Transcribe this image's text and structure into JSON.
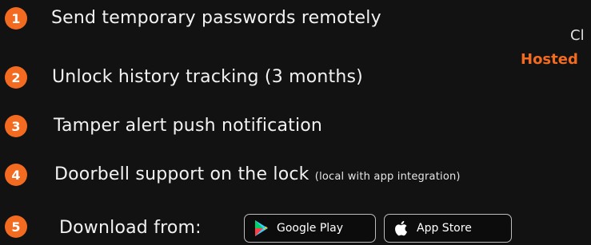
{
  "features": [
    {
      "number": "1",
      "text": "Send temporary passwords remotely"
    },
    {
      "number": "2",
      "text": "Unlock history tracking (3 months)"
    },
    {
      "number": "3",
      "text": "Tamper alert push notification"
    },
    {
      "number": "4",
      "text": "Doorbell support on the lock",
      "note": "(local with app integration)"
    },
    {
      "number": "5",
      "text": "Download from:"
    }
  ],
  "stores": {
    "google_play": {
      "label": "Google Play",
      "icon": "google-play-icon"
    },
    "app_store": {
      "label": "App Store",
      "icon": "apple-icon"
    }
  },
  "side": {
    "partial_top": "Cl",
    "partial_hosted": "Hosted"
  },
  "colors": {
    "accent": "#f26b21",
    "background": "#121212",
    "text": "#f2f2f2"
  }
}
